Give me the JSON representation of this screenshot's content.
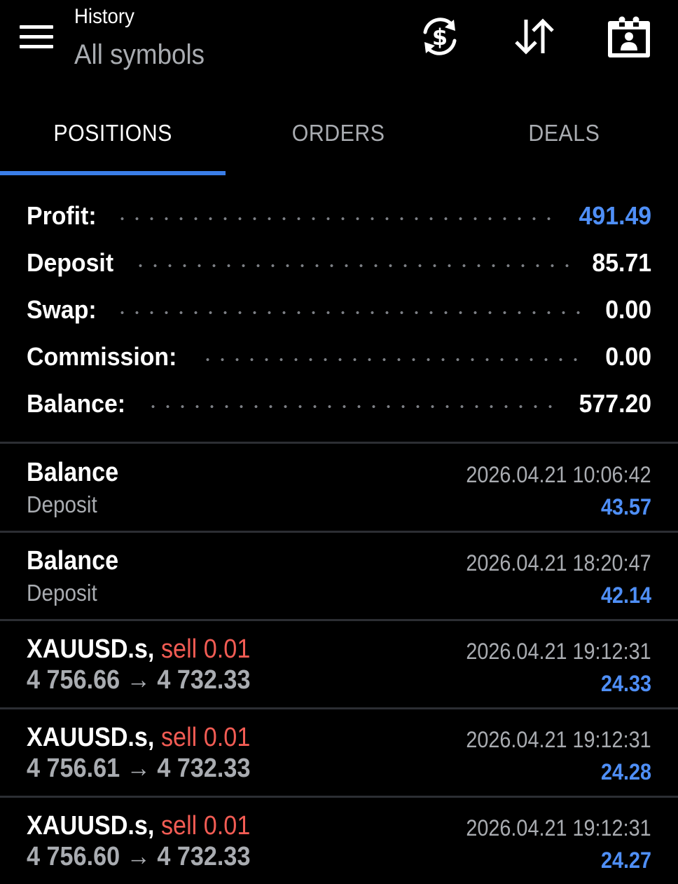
{
  "header": {
    "title": "History",
    "subtitle": "All symbols",
    "icons": [
      "currency-exchange-icon",
      "sort-icon",
      "calendar-icon"
    ]
  },
  "tabs": [
    {
      "label": "POSITIONS",
      "active": true
    },
    {
      "label": "ORDERS",
      "active": false
    },
    {
      "label": "DEALS",
      "active": false
    }
  ],
  "summary": {
    "profit": {
      "label": "Profit:",
      "value": "491.49"
    },
    "deposit": {
      "label": "Deposit",
      "value": "85.71"
    },
    "swap": {
      "label": "Swap:",
      "value": "0.00"
    },
    "commission": {
      "label": "Commission:",
      "value": "0.00"
    },
    "balance": {
      "label": "Balance:",
      "value": "577.20"
    }
  },
  "items": [
    {
      "title": "Balance",
      "subtitle": "Deposit",
      "time": "2026.04.21 10:06:42",
      "amount": "43.57"
    },
    {
      "title": "Balance",
      "subtitle": "Deposit",
      "time": "2026.04.21 18:20:47",
      "amount": "42.14"
    },
    {
      "symbol": "XAUUSD.s,",
      "side": "sell 0.01",
      "open_price": "4 756.66",
      "arrow": "→",
      "close_price": "4 732.33",
      "time": "2026.04.21 19:12:31",
      "amount": "24.33"
    },
    {
      "symbol": "XAUUSD.s,",
      "side": "sell 0.01",
      "open_price": "4 756.61",
      "arrow": "→",
      "close_price": "4 732.33",
      "time": "2026.04.21 19:12:31",
      "amount": "24.28"
    },
    {
      "symbol": "XAUUSD.s,",
      "side": "sell 0.01",
      "open_price": "4 756.60",
      "arrow": "→",
      "close_price": "4 732.33",
      "time": "2026.04.21 19:12:31",
      "amount": "24.27"
    }
  ],
  "colors": {
    "background": "#000000",
    "accent": "#3a7ee8",
    "profit_value": "#4f8ff7",
    "sell": "#f25c54",
    "muted_text": "#a9acb1",
    "divider": "#2c2e33"
  }
}
